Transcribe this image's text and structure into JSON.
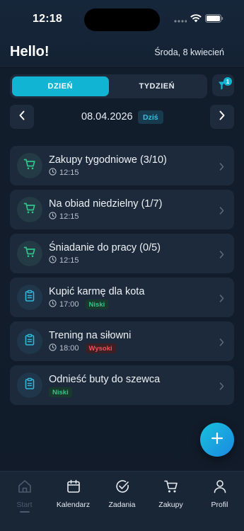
{
  "status": {
    "time": "12:18"
  },
  "header": {
    "greeting": "Hello!",
    "date": "Środa, 8 kwiecień"
  },
  "segmented": {
    "day": "DZIEŃ",
    "week": "TYDZIEŃ",
    "active": "day"
  },
  "filter": {
    "badge": "1",
    "icon": "filter-icon"
  },
  "date_nav": {
    "date": "08.04.2026",
    "today": "Dziś"
  },
  "tasks": [
    {
      "title": "Zakupy tygodniowe (3/10)",
      "time": "12:15",
      "icon": "cart-icon",
      "priority": ""
    },
    {
      "title": "Na obiad niedzielny (1/7)",
      "time": "12:15",
      "icon": "cart-icon",
      "priority": ""
    },
    {
      "title": "Śniadanie do pracy (0/5)",
      "time": "12:15",
      "icon": "cart-icon",
      "priority": ""
    },
    {
      "title": "Kupić karmę dla kota",
      "time": "17:00",
      "icon": "clipboard-icon",
      "priority": "Niski"
    },
    {
      "title": "Trening na siłowni",
      "time": "18:00",
      "icon": "clipboard-icon",
      "priority": "Wysoki"
    },
    {
      "title": "Odnieść buty do szewca",
      "time": "",
      "icon": "clipboard-icon",
      "priority": "Niski"
    }
  ],
  "fab": {
    "icon": "plus-icon"
  },
  "tabbar": {
    "items": [
      {
        "label": "Start",
        "icon": "home-icon",
        "active": true
      },
      {
        "label": "Kalendarz",
        "icon": "calendar-icon",
        "active": false
      },
      {
        "label": "Zadania",
        "icon": "check-circle-icon",
        "active": false
      },
      {
        "label": "Zakupy",
        "icon": "cart-icon",
        "active": false
      },
      {
        "label": "Profil",
        "icon": "person-icon",
        "active": false
      }
    ]
  },
  "colors": {
    "accent": "#11b5d3",
    "background": "#111b29",
    "card": "#1d2a3b",
    "priority_low": "#2fc58a",
    "priority_high": "#f2505c"
  }
}
